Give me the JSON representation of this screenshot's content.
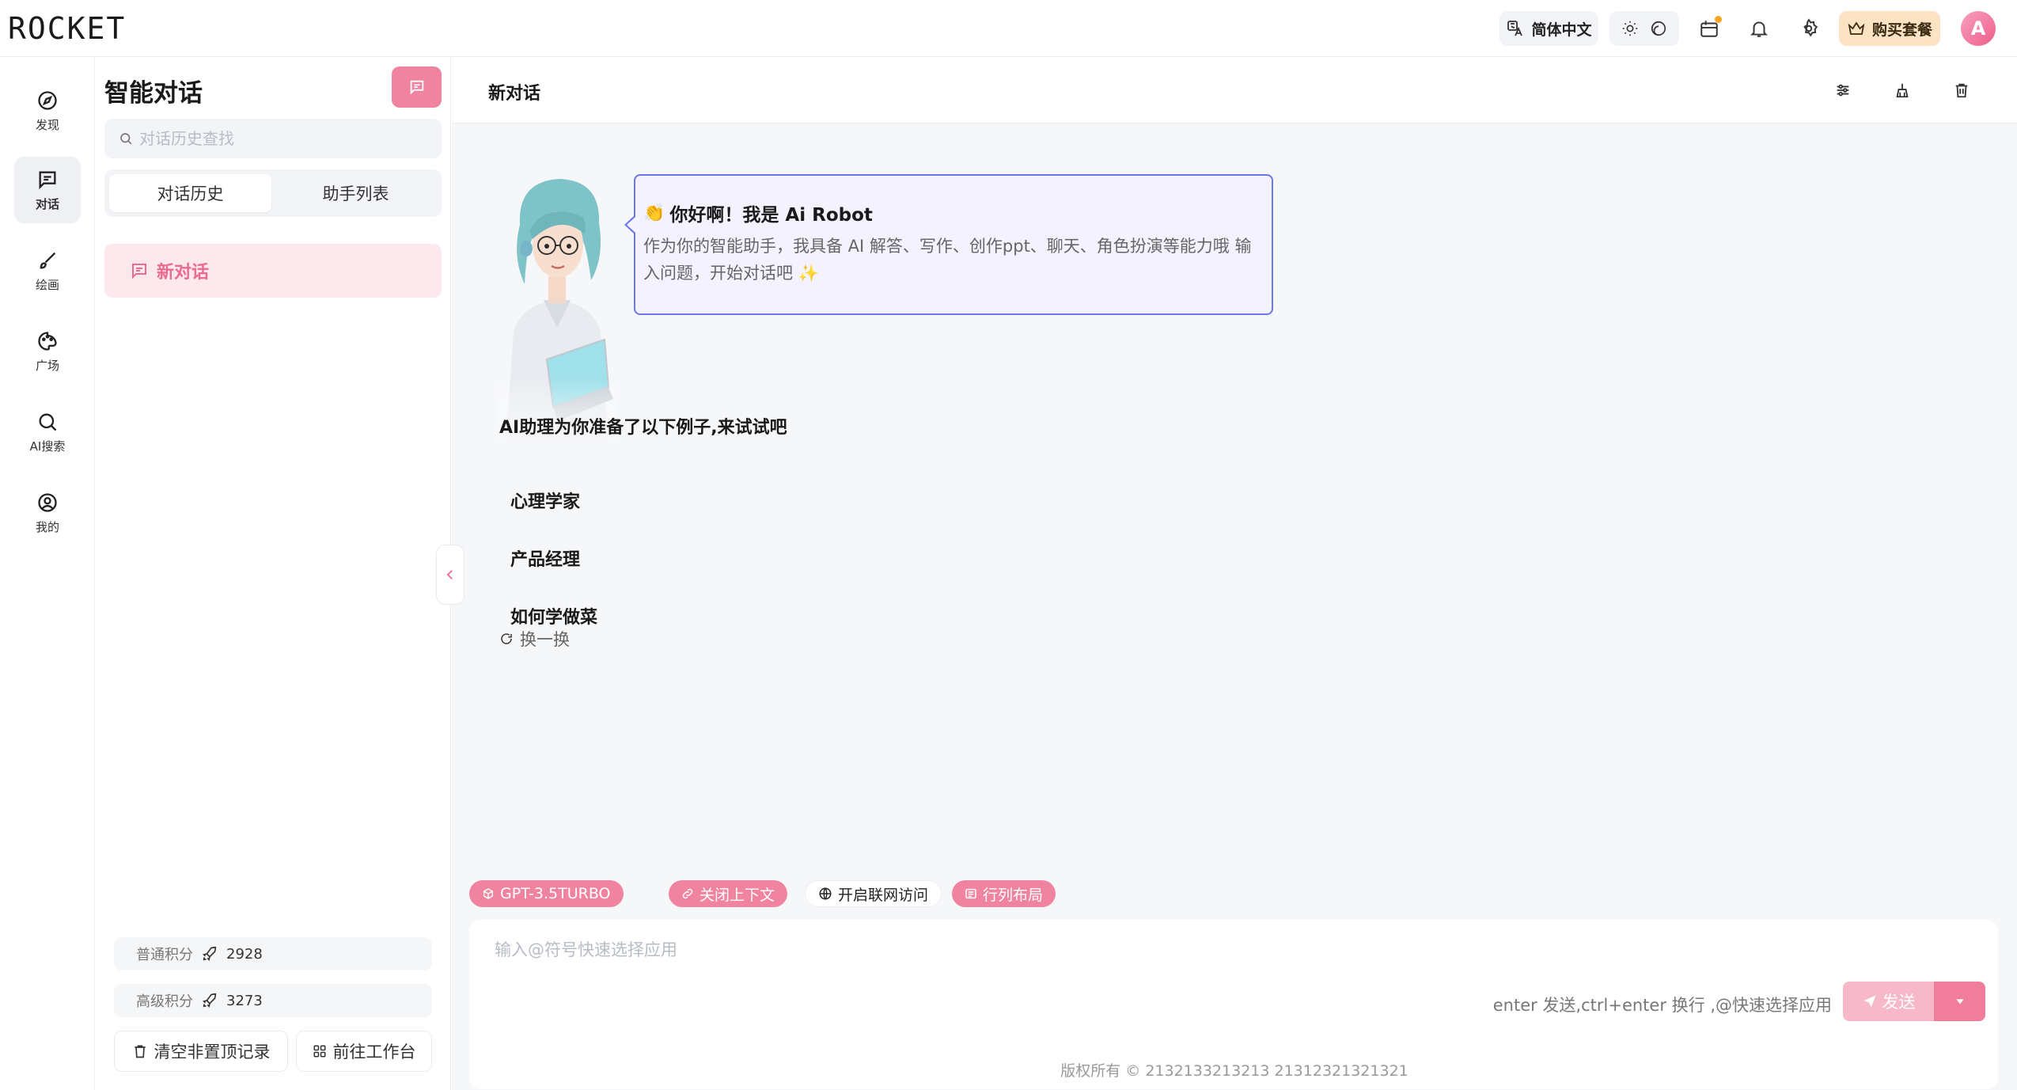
{
  "app": {
    "logo_text": "ROCKET"
  },
  "topbar": {
    "language_label": "简体中文",
    "buy_label": "购买套餐",
    "avatar_letter": "A"
  },
  "nav": {
    "items": [
      {
        "label": "发现",
        "icon": "compass-icon"
      },
      {
        "label": "对话",
        "icon": "chat-icon"
      },
      {
        "label": "绘画",
        "icon": "brush-icon"
      },
      {
        "label": "广场",
        "icon": "palette-icon"
      },
      {
        "label": "AI搜索",
        "icon": "search-icon"
      },
      {
        "label": "我的",
        "icon": "user-circle-icon"
      }
    ],
    "active_index": 1
  },
  "sidebar": {
    "title": "智能对话",
    "search_placeholder": "对话历史查找",
    "tabs": [
      {
        "label": "对话历史"
      },
      {
        "label": "助手列表"
      }
    ],
    "conversations": [
      {
        "label": "新对话"
      }
    ],
    "points": [
      {
        "label": "普通积分",
        "value": "2928"
      },
      {
        "label": "高级积分",
        "value": "3273"
      }
    ],
    "clear_label": "清空非置顶记录",
    "workspace_label": "前往工作台"
  },
  "main": {
    "title": "新对话",
    "greeting": {
      "title": "你好啊！我是 Ai Robot",
      "body": "作为你的智能助手，我具备 AI 解答、写作、创作ppt、聊天、角色扮演等能力哦 输入问题，开始对话吧"
    },
    "examples_title": "AI助理为你准备了以下例子,来试试吧",
    "examples": [
      "心理学家",
      "产品经理",
      "如何学做菜"
    ],
    "refresh_label": "换一换"
  },
  "composer": {
    "model_label": "GPT-3.5TURBO",
    "context_label": "关闭上下文",
    "web_label": "开启联网访问",
    "layout_label": "行列布局",
    "placeholder": "输入@符号快速选择应用",
    "hint": "enter 发送,ctrl+enter 换行 ,@快速选择应用",
    "send_label": "发送"
  },
  "footer": {
    "copyright": "版权所有 © 2132133213213  21312321321321"
  },
  "colors": {
    "accent": "#f0839f",
    "accent_dark": "#ef7d9b",
    "bubble_border": "#6a78ee",
    "buy_bg": "#fbe3c4"
  }
}
